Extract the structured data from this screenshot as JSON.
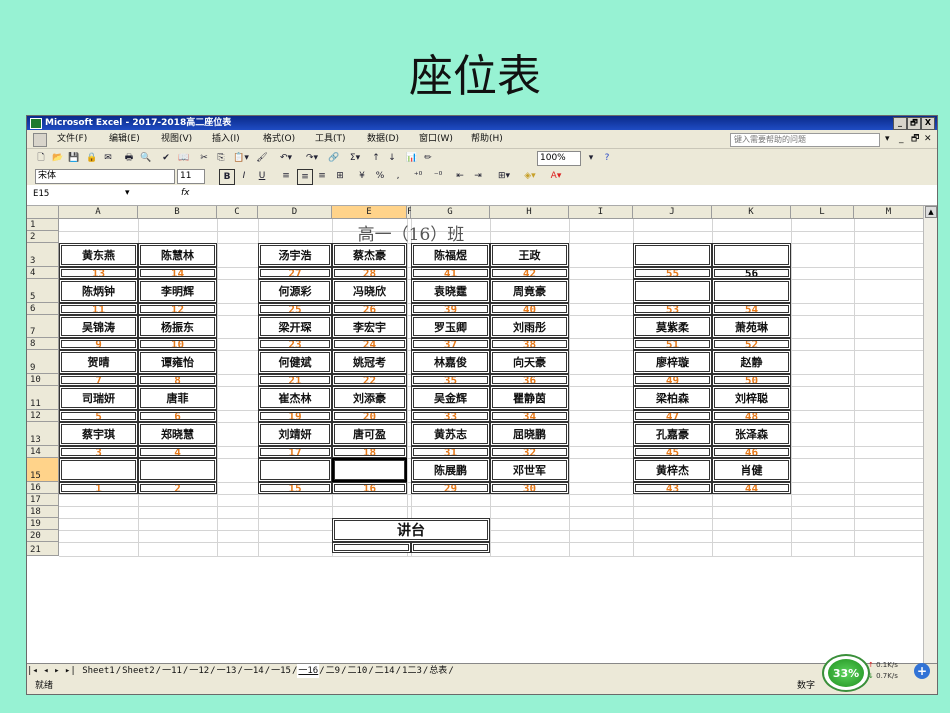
{
  "slide_title": "座位表",
  "window": {
    "title": "Microsoft Excel - 2017-2018高二座位表",
    "controls": [
      "_",
      "🗗",
      "X"
    ]
  },
  "menu": {
    "items": [
      "文件(F)",
      "编辑(E)",
      "视图(V)",
      "插入(I)",
      "格式(O)",
      "工具(T)",
      "数据(D)",
      "窗口(W)",
      "帮助(H)"
    ],
    "help_placeholder": "键入需要帮助的问题"
  },
  "toolbar": {
    "zoom": "100%",
    "font_name": "宋体",
    "font_size": "11",
    "bold": "B",
    "italic": "I",
    "underline": "U",
    "percent": "%"
  },
  "formula_bar": {
    "name_box": "E15",
    "fx": "fx"
  },
  "columns": [
    "A",
    "B",
    "C",
    "D",
    "E",
    "F",
    "G",
    "H",
    "I",
    "J",
    "K",
    "L",
    "M"
  ],
  "rows": [
    "1",
    "2",
    "3",
    "4",
    "5",
    "6",
    "7",
    "8",
    "9",
    "10",
    "11",
    "12",
    "13",
    "14",
    "15",
    "16",
    "17",
    "18",
    "19",
    "20",
    "21"
  ],
  "class_title": "高一（16）班",
  "seats": {
    "names": [
      [
        "黄东燕",
        "陈慧林",
        "汤宇浩",
        "蔡杰豪",
        "陈福煜",
        "王政",
        "",
        ""
      ],
      [
        "陈炳钟",
        "李明辉",
        "何源彩",
        "冯晓欣",
        "袁晓霆",
        "周竟豪",
        "",
        ""
      ],
      [
        "吴锦涛",
        "杨振东",
        "梁开琛",
        "李宏宇",
        "罗玉卿",
        "刘雨彤",
        "莫紫柔",
        "萧苑琳"
      ],
      [
        "贺晴",
        "谭雍怡",
        "何健斌",
        "姚冠考",
        "林嘉俊",
        "向天豪",
        "廖梓璇",
        "赵静"
      ],
      [
        "司瑞妍",
        "唐菲",
        "崔杰林",
        "刘添豪",
        "吴金辉",
        "瞿静茵",
        "梁柏森",
        "刘梓聪"
      ],
      [
        "蔡宇琪",
        "郑晓慧",
        "刘靖妍",
        "唐可盈",
        "黄苏志",
        "屈晓鹏",
        "孔嘉豪",
        "张泽森"
      ],
      [
        "",
        "",
        "",
        "",
        "陈展鹏",
        "邓世军",
        "黄梓杰",
        "肖健"
      ]
    ],
    "numbers": [
      [
        "13",
        "14",
        "27",
        "28",
        "41",
        "42",
        "55",
        "56"
      ],
      [
        "11",
        "12",
        "25",
        "26",
        "39",
        "40",
        "53",
        "54"
      ],
      [
        "9",
        "10",
        "23",
        "24",
        "37",
        "38",
        "51",
        "52"
      ],
      [
        "7",
        "8",
        "21",
        "22",
        "35",
        "36",
        "49",
        "50"
      ],
      [
        "5",
        "6",
        "19",
        "20",
        "33",
        "34",
        "47",
        "48"
      ],
      [
        "3",
        "4",
        "17",
        "18",
        "31",
        "32",
        "45",
        "46"
      ],
      [
        "1",
        "2",
        "15",
        "16",
        "29",
        "30",
        "43",
        "44"
      ]
    ],
    "black_number": "56"
  },
  "podium": "讲台",
  "sheet_tabs": [
    "Sheet1",
    "Sheet2",
    "一11",
    "一12",
    "一13",
    "一14",
    "一15",
    "一16",
    "二9",
    "二10",
    "二14",
    "1二3",
    "总表"
  ],
  "active_tab": "一16",
  "status": {
    "left": "就绪",
    "right": "数字"
  },
  "net_widget": {
    "percent": "33%",
    "up": "0.1K/s",
    "down": "0.7K/s"
  },
  "colors": {
    "background": "#97f2d3",
    "seat_number": "#e77b1c"
  }
}
